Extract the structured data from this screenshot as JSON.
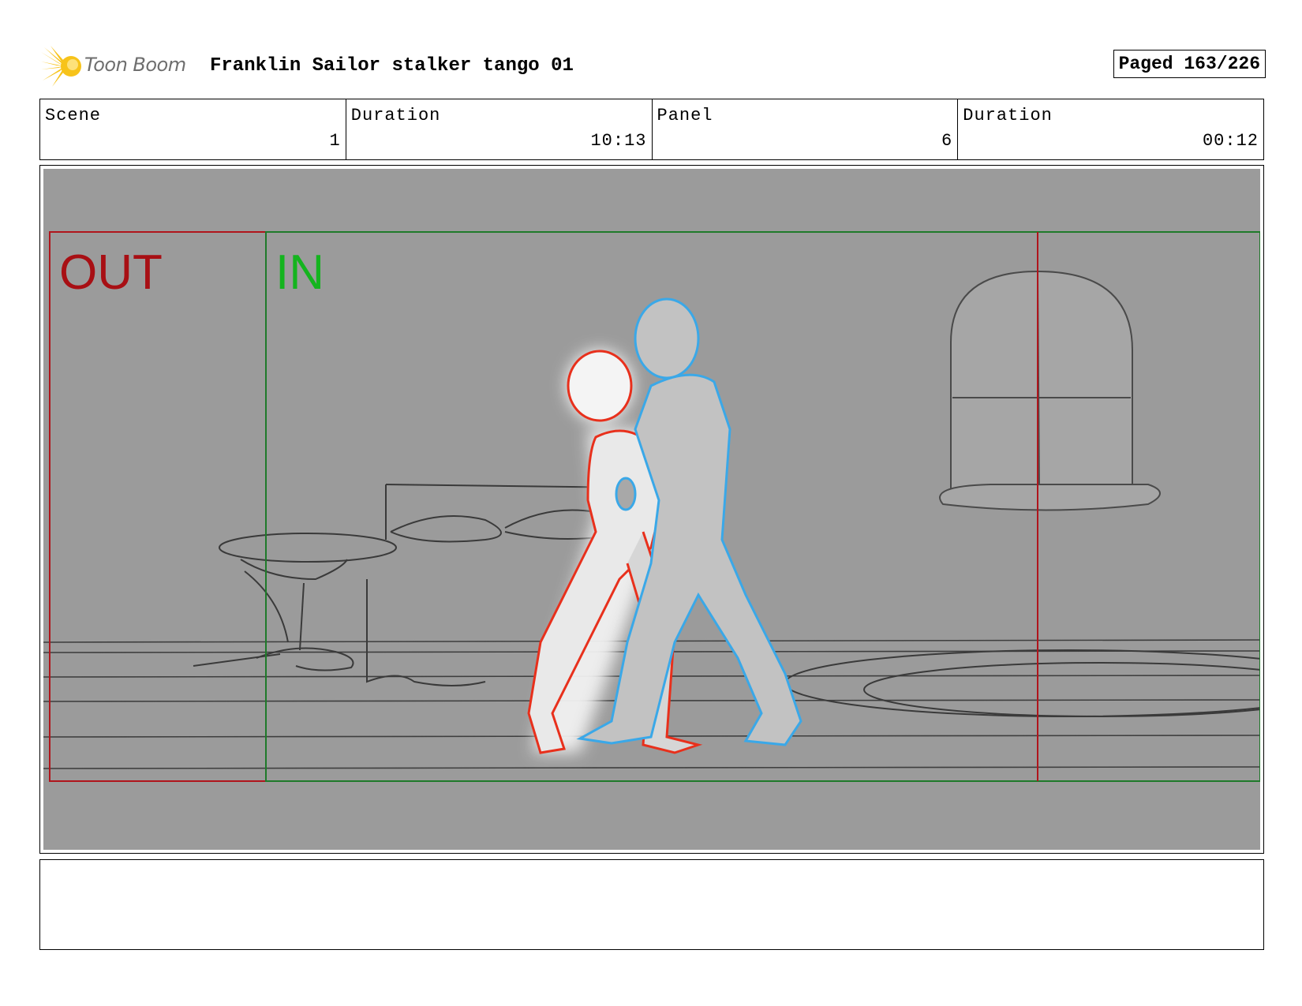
{
  "header": {
    "logo_text": "Toon Boom",
    "title": "Franklin Sailor stalker tango 01",
    "page": "Paged 163/226"
  },
  "info": {
    "scene_label": "Scene",
    "scene_value": "1",
    "scene_duration_label": "Duration",
    "scene_duration_value": "10:13",
    "panel_label": "Panel",
    "panel_value": "6",
    "panel_duration_label": "Duration",
    "panel_duration_value": "00:12"
  },
  "panel": {
    "out_label": "OUT",
    "in_label": "IN",
    "colors": {
      "background": "#9b9b9b",
      "out_frame": "#b0151c",
      "in_frame": "#1f7a2a",
      "out_text": "#a80f14",
      "in_text": "#14b41e",
      "character_red": "#e8301c",
      "character_blue": "#3aa8e8"
    }
  },
  "notes": {
    "text": ""
  }
}
